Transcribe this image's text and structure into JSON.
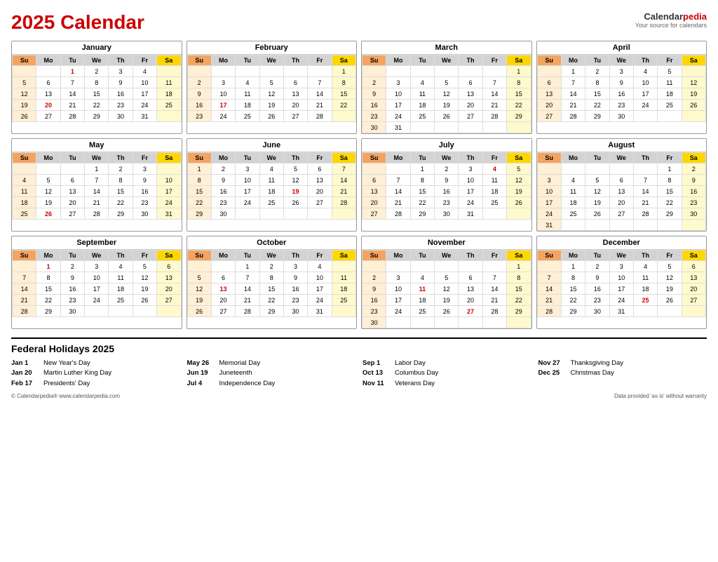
{
  "header": {
    "title_part1": "2025 ",
    "title_part2": "Calendar",
    "brand_name": "Calendar",
    "brand_pedia": "pedia",
    "brand_sub": "Your source for calendars"
  },
  "months": [
    {
      "name": "January",
      "days": [
        [
          "",
          "",
          "1",
          "2",
          "3",
          "4"
        ],
        [
          "5",
          "6",
          "7",
          "8",
          "9",
          "10",
          "11"
        ],
        [
          "12",
          "13",
          "14",
          "15",
          "16",
          "17",
          "18"
        ],
        [
          "19",
          "20",
          "21",
          "22",
          "23",
          "24",
          "25"
        ],
        [
          "26",
          "27",
          "28",
          "29",
          "30",
          "31",
          ""
        ]
      ],
      "special": {
        "red": [
          "1",
          "20"
        ],
        "col_end_empty": false
      }
    },
    {
      "name": "February",
      "days": [
        [
          "",
          "",
          "",
          "",
          "",
          "",
          "1"
        ],
        [
          "2",
          "3",
          "4",
          "5",
          "6",
          "7",
          "8"
        ],
        [
          "9",
          "10",
          "11",
          "12",
          "13",
          "14",
          "15"
        ],
        [
          "16",
          "17",
          "18",
          "19",
          "20",
          "21",
          "22"
        ],
        [
          "23",
          "24",
          "25",
          "26",
          "27",
          "28",
          ""
        ]
      ],
      "special": {
        "red": [
          "17"
        ]
      }
    },
    {
      "name": "March",
      "days": [
        [
          "",
          "",
          "",
          "",
          "",
          "",
          "1"
        ],
        [
          "2",
          "3",
          "4",
          "5",
          "6",
          "7",
          "8"
        ],
        [
          "9",
          "10",
          "11",
          "12",
          "13",
          "14",
          "15"
        ],
        [
          "16",
          "17",
          "18",
          "19",
          "20",
          "21",
          "22"
        ],
        [
          "23",
          "24",
          "25",
          "26",
          "27",
          "28",
          "29"
        ],
        [
          "30",
          "31",
          "",
          "",
          "",
          "",
          ""
        ]
      ],
      "special": {
        "red": []
      }
    },
    {
      "name": "April",
      "days": [
        [
          "",
          "1",
          "2",
          "3",
          "4",
          "5"
        ],
        [
          "6",
          "7",
          "8",
          "9",
          "10",
          "11",
          "12"
        ],
        [
          "13",
          "14",
          "15",
          "16",
          "17",
          "18",
          "19"
        ],
        [
          "20",
          "21",
          "22",
          "23",
          "24",
          "25",
          "26"
        ],
        [
          "27",
          "28",
          "29",
          "30",
          "",
          "",
          ""
        ]
      ],
      "special": {
        "red": []
      }
    },
    {
      "name": "May",
      "days": [
        [
          "",
          "",
          "",
          "1",
          "2",
          "3"
        ],
        [
          "4",
          "5",
          "6",
          "7",
          "8",
          "9",
          "10"
        ],
        [
          "11",
          "12",
          "13",
          "14",
          "15",
          "16",
          "17"
        ],
        [
          "18",
          "19",
          "20",
          "21",
          "22",
          "23",
          "24"
        ],
        [
          "25",
          "26",
          "27",
          "28",
          "29",
          "30",
          "31"
        ]
      ],
      "special": {
        "red": [
          "26"
        ]
      }
    },
    {
      "name": "June",
      "days": [
        [
          "1",
          "2",
          "3",
          "4",
          "5",
          "6",
          "7"
        ],
        [
          "8",
          "9",
          "10",
          "11",
          "12",
          "13",
          "14"
        ],
        [
          "15",
          "16",
          "17",
          "18",
          "19",
          "20",
          "21"
        ],
        [
          "22",
          "23",
          "24",
          "25",
          "26",
          "27",
          "28"
        ],
        [
          "29",
          "30",
          "",
          "",
          "",
          "",
          ""
        ]
      ],
      "special": {
        "red": [
          "19"
        ]
      }
    },
    {
      "name": "July",
      "days": [
        [
          "",
          "",
          "1",
          "2",
          "3",
          "4",
          "5"
        ],
        [
          "6",
          "7",
          "8",
          "9",
          "10",
          "11",
          "12"
        ],
        [
          "13",
          "14",
          "15",
          "16",
          "17",
          "18",
          "19"
        ],
        [
          "20",
          "21",
          "22",
          "23",
          "24",
          "25",
          "26"
        ],
        [
          "27",
          "28",
          "29",
          "30",
          "31",
          "",
          ""
        ]
      ],
      "special": {
        "red": [
          "4"
        ]
      }
    },
    {
      "name": "August",
      "days": [
        [
          "",
          "",
          "",
          "",
          "",
          "1",
          "2"
        ],
        [
          "3",
          "4",
          "5",
          "6",
          "7",
          "8",
          "9"
        ],
        [
          "10",
          "11",
          "12",
          "13",
          "14",
          "15",
          "16"
        ],
        [
          "17",
          "18",
          "19",
          "20",
          "21",
          "22",
          "23"
        ],
        [
          "24",
          "25",
          "26",
          "27",
          "28",
          "29",
          "30"
        ],
        [
          "31",
          "",
          "",
          "",
          "",
          "",
          ""
        ]
      ],
      "special": {
        "red": []
      }
    },
    {
      "name": "September",
      "days": [
        [
          "",
          "1",
          "2",
          "3",
          "4",
          "5",
          "6"
        ],
        [
          "7",
          "8",
          "9",
          "10",
          "11",
          "12",
          "13"
        ],
        [
          "14",
          "15",
          "16",
          "17",
          "18",
          "19",
          "20"
        ],
        [
          "21",
          "22",
          "23",
          "24",
          "25",
          "26",
          "27"
        ],
        [
          "28",
          "29",
          "30",
          "",
          "",
          "",
          ""
        ]
      ],
      "special": {
        "red": [
          "1"
        ]
      }
    },
    {
      "name": "October",
      "days": [
        [
          "",
          "",
          "1",
          "2",
          "3",
          "4"
        ],
        [
          "5",
          "6",
          "7",
          "8",
          "9",
          "10",
          "11"
        ],
        [
          "12",
          "13",
          "14",
          "15",
          "16",
          "17",
          "18"
        ],
        [
          "19",
          "20",
          "21",
          "22",
          "23",
          "24",
          "25"
        ],
        [
          "26",
          "27",
          "28",
          "29",
          "30",
          "31",
          ""
        ]
      ],
      "special": {
        "red": [
          "13"
        ]
      }
    },
    {
      "name": "November",
      "days": [
        [
          "",
          "",
          "",
          "",
          "",
          "",
          "1"
        ],
        [
          "2",
          "3",
          "4",
          "5",
          "6",
          "7",
          "8"
        ],
        [
          "9",
          "10",
          "11",
          "12",
          "13",
          "14",
          "15"
        ],
        [
          "16",
          "17",
          "18",
          "19",
          "20",
          "21",
          "22"
        ],
        [
          "23",
          "24",
          "25",
          "26",
          "27",
          "28",
          "29"
        ],
        [
          "30",
          "",
          "",
          "",
          "",
          "",
          ""
        ]
      ],
      "special": {
        "red": [
          "11",
          "27"
        ]
      }
    },
    {
      "name": "December",
      "days": [
        [
          "",
          "1",
          "2",
          "3",
          "4",
          "5",
          "6"
        ],
        [
          "7",
          "8",
          "9",
          "10",
          "11",
          "12",
          "13"
        ],
        [
          "14",
          "15",
          "16",
          "17",
          "18",
          "19",
          "20"
        ],
        [
          "21",
          "22",
          "23",
          "24",
          "25",
          "26",
          "27"
        ],
        [
          "28",
          "29",
          "30",
          "31",
          "",
          "",
          ""
        ]
      ],
      "special": {
        "red": [
          "25"
        ]
      }
    }
  ],
  "weekdays": [
    "Su",
    "Mo",
    "Tu",
    "We",
    "Th",
    "Fr",
    "Sa"
  ],
  "holidays_title": "Federal Holidays 2025",
  "holidays": [
    [
      {
        "date": "Jan 1",
        "name": "New Year's Day"
      },
      {
        "date": "Jan 20",
        "name": "Martin Luther King Day"
      },
      {
        "date": "Feb 17",
        "name": "Presidents' Day"
      }
    ],
    [
      {
        "date": "May 26",
        "name": "Memorial Day"
      },
      {
        "date": "Jun 19",
        "name": "Juneteenth"
      },
      {
        "date": "Jul 4",
        "name": "Independence Day"
      }
    ],
    [
      {
        "date": "Sep 1",
        "name": "Labor Day"
      },
      {
        "date": "Oct 13",
        "name": "Columbus Day"
      },
      {
        "date": "Nov 11",
        "name": "Veterans Day"
      }
    ],
    [
      {
        "date": "Nov 27",
        "name": "Thanksgiving Day"
      },
      {
        "date": "Dec 25",
        "name": "Christmas Day"
      }
    ]
  ],
  "footer_left": "© Calendarpedia®   www.calendarpedia.com",
  "footer_right": "Data provided 'as is' without warranty"
}
